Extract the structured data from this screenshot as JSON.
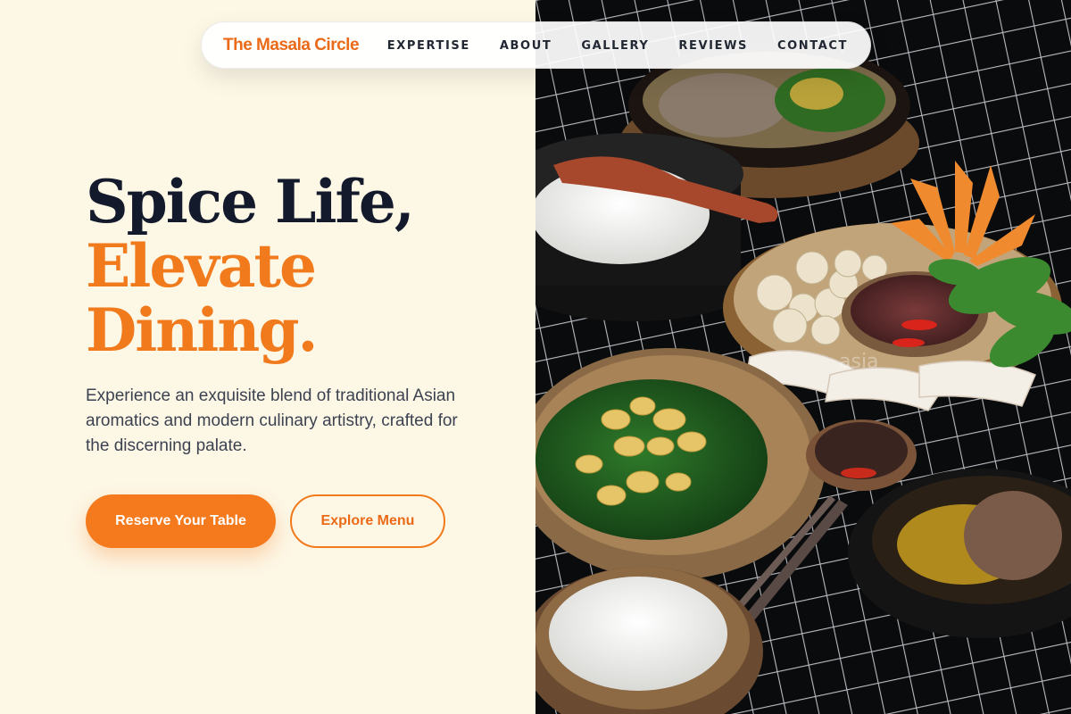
{
  "nav": {
    "brand": "The Masala Circle",
    "links": [
      "EXPERTISE",
      "ABOUT",
      "GALLERY",
      "REVIEWS",
      "CONTACT"
    ]
  },
  "hero": {
    "headline_line1": "Spice Life,",
    "headline_line2": "Elevate",
    "headline_line3": "Dining.",
    "description": "Experience an exquisite blend of traditional Asian aromatics and modern culinary artistry, crafted for the discerning palate.",
    "primary_cta": "Reserve Your Table",
    "secondary_cta": "Explore Menu"
  },
  "photo": {
    "watermark": "asia"
  },
  "colors": {
    "background": "#fdf7e6",
    "accent": "#f07a1c",
    "heading": "#131a2b",
    "body_text": "#3c4250"
  }
}
